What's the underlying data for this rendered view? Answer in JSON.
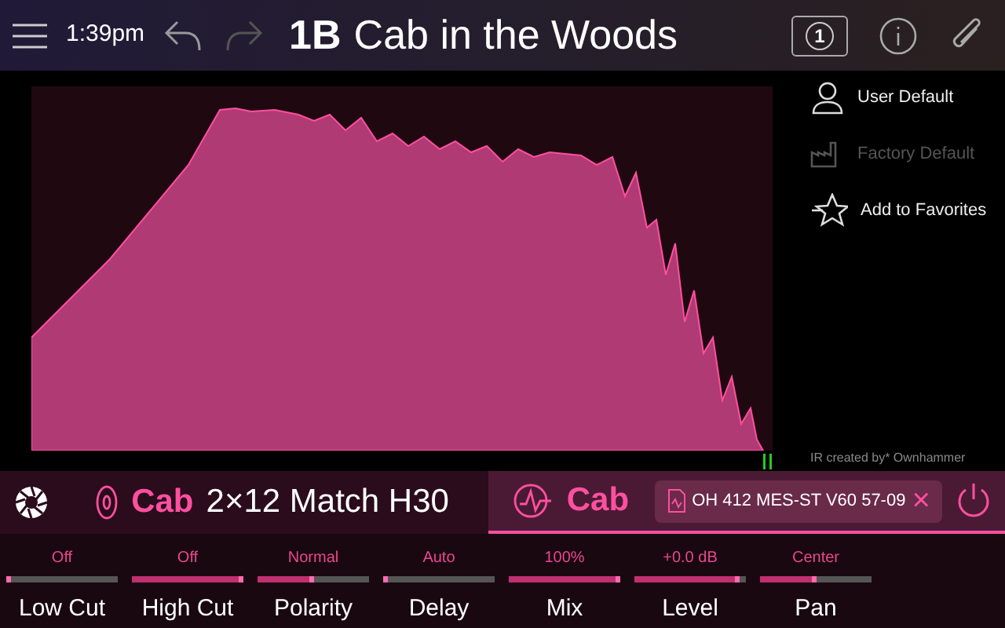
{
  "header": {
    "time": "1:39pm",
    "preset_id": "1B",
    "preset_name": "Cab in the Woods",
    "snapshot_number": "1"
  },
  "side_menu": [
    {
      "label": "User Default",
      "disabled": false,
      "kind": "user"
    },
    {
      "label": "Factory Default",
      "disabled": true,
      "kind": "factory"
    },
    {
      "label": "Add to Favorites",
      "disabled": false,
      "kind": "favorite"
    }
  ],
  "ir_credit": "IR created by* Ownhammer",
  "blocks": [
    {
      "type": "Cab",
      "model": "2×12 Match H30",
      "selected": false,
      "kind": "cab"
    },
    {
      "type": "Cab",
      "model": "OH 412 MES-ST V60 57-09",
      "selected": true,
      "kind": "ir"
    }
  ],
  "close_symbol": "×",
  "params": [
    {
      "name": "Low Cut",
      "value": "Off",
      "level": 0.04
    },
    {
      "name": "High Cut",
      "value": "Off",
      "level": 1.0
    },
    {
      "name": "Polarity",
      "value": "Normal",
      "level": 0.5
    },
    {
      "name": "Delay",
      "value": "Auto",
      "level": 0.04
    },
    {
      "name": "Mix",
      "value": "100%",
      "level": 1.0
    },
    {
      "name": "Level",
      "value": "+0.0 dB",
      "level": 0.95
    },
    {
      "name": "Pan",
      "value": "Center",
      "level": 0.5
    }
  ]
}
